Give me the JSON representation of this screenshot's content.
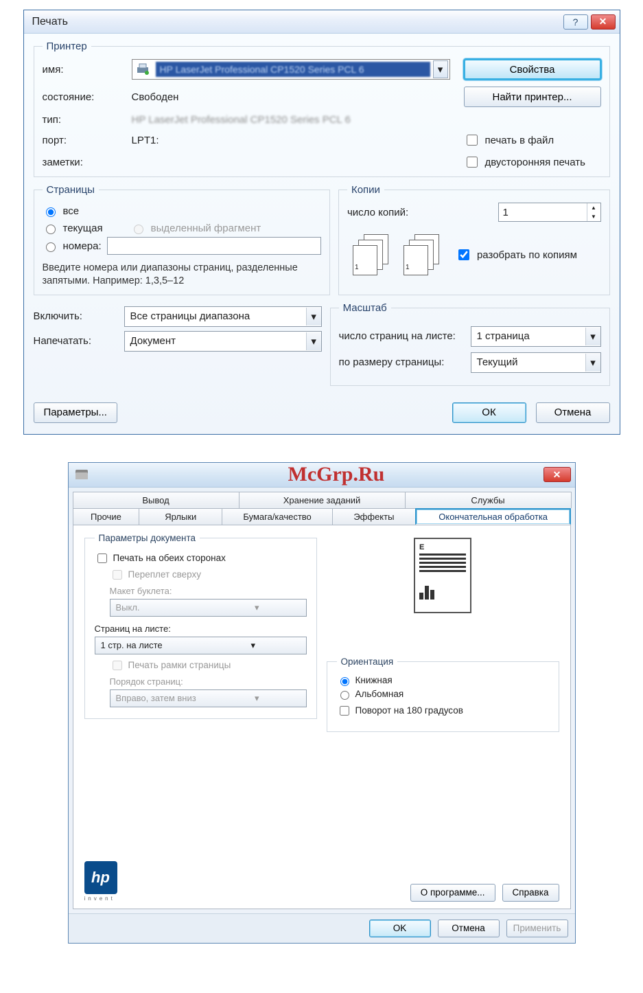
{
  "dialog1": {
    "title": "Печать",
    "help_symbol": "?",
    "close_symbol": "✕",
    "printer_legend": "Принтер",
    "name_label": "имя:",
    "name_value": "HP LaserJet Professional CP1520 Series PCL 6",
    "properties_btn": "Свойства",
    "find_printer_btn": "Найти принтер...",
    "status_label": "состояние:",
    "status_value": "Свободен",
    "type_label": "тип:",
    "type_value": "HP LaserJet Professional CP1520 Series PCL 6",
    "port_label": "порт:",
    "port_value": "LPT1:",
    "notes_label": "заметки:",
    "print_to_file": "печать в файл",
    "duplex": "двусторонняя печать",
    "pages_legend": "Страницы",
    "pages_all": "все",
    "pages_current": "текущая",
    "pages_selection": "выделенный фрагмент",
    "pages_numbers": "номера:",
    "pages_hint": "Введите номера или диапазоны страниц, разделенные запятыми. Например: 1,3,5–12",
    "copies_legend": "Копии",
    "copies_label": "число копий:",
    "copies_value": "1",
    "collate": "разобрать по копиям",
    "include_label": "Включить:",
    "include_value": "Все страницы диапазона",
    "print_label": "Напечатать:",
    "print_value": "Документ",
    "scale_legend": "Масштаб",
    "pages_per_sheet_label": "число страниц на листе:",
    "pages_per_sheet_value": "1 страница",
    "fit_label": "по размеру страницы:",
    "fit_value": "Текущий",
    "params_btn": "Параметры...",
    "ok_btn": "ОК",
    "cancel_btn": "Отмена"
  },
  "dialog2": {
    "watermark": "McGrp.Ru",
    "close_symbol": "✕",
    "tabs_row1": [
      "Вывод",
      "Хранение заданий",
      "Службы"
    ],
    "tabs_row2": [
      "Прочие",
      "Ярлыки",
      "Бумага/качество",
      "Эффекты",
      "Окончательная обработка"
    ],
    "active_tab_index": 4,
    "doc_params_legend": "Параметры документа",
    "print_both_sides": "Печать на обеих сторонах",
    "flip_up": "Переплет сверху",
    "booklet_label": "Макет буклета:",
    "booklet_value": "Выкл.",
    "pps_label": "Страниц на листе:",
    "pps_value": "1 стр. на листе",
    "print_borders": "Печать рамки страницы",
    "page_order_label": "Порядок страниц:",
    "page_order_value": "Вправо, затем вниз",
    "orientation_legend": "Ориентация",
    "portrait": "Книжная",
    "landscape": "Альбомная",
    "rotate180": "Поворот на 180 градусов",
    "about_btn": "О программе...",
    "help_btn": "Справка",
    "invent": "invent",
    "ok_btn": "OK",
    "cancel_btn": "Отмена",
    "apply_btn": "Применить"
  }
}
